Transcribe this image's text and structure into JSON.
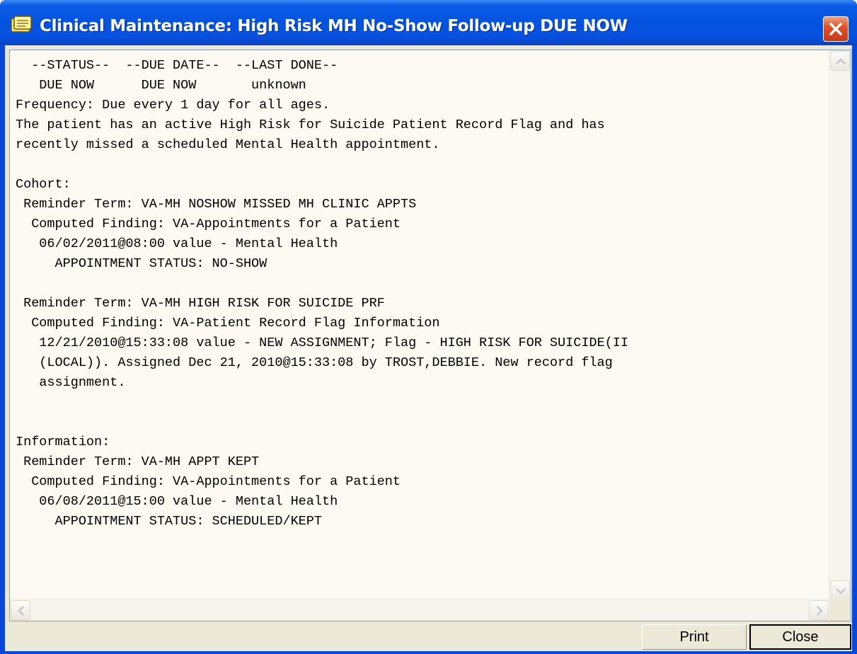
{
  "window": {
    "title": "Clinical Maintenance: High Risk MH No-Show Follow-up DUE NOW",
    "title_icon": "notepad-icon",
    "close_icon": "close-icon"
  },
  "colors": {
    "titlebar": "#0453de",
    "close_button": "#e0522c",
    "text_background": "#fdfaf3",
    "dialog_face": "#ece9d8"
  },
  "content": {
    "text": "  --STATUS--  --DUE DATE--  --LAST DONE--\n   DUE NOW      DUE NOW       unknown\nFrequency: Due every 1 day for all ages.\nThe patient has an active High Risk for Suicide Patient Record Flag and has\nrecently missed a scheduled Mental Health appointment.\n\nCohort:\n Reminder Term: VA-MH NOSHOW MISSED MH CLINIC APPTS\n  Computed Finding: VA-Appointments for a Patient\n   06/02/2011@08:00 value - Mental Health\n     APPOINTMENT STATUS: NO-SHOW\n\n Reminder Term: VA-MH HIGH RISK FOR SUICIDE PRF\n  Computed Finding: VA-Patient Record Flag Information\n   12/21/2010@15:33:08 value - NEW ASSIGNMENT; Flag - HIGH RISK FOR SUICIDE(II\n   (LOCAL)). Assigned Dec 21, 2010@15:33:08 by TROST,DEBBIE. New record flag\n   assignment.\n\n\nInformation:\n Reminder Term: VA-MH APPT KEPT\n  Computed Finding: VA-Appointments for a Patient\n   06/08/2011@15:00 value - Mental Health\n     APPOINTMENT STATUS: SCHEDULED/KEPT"
  },
  "scrollbars": {
    "up_icon": "scroll-up-icon",
    "down_icon": "scroll-down-icon",
    "left_icon": "scroll-left-icon",
    "right_icon": "scroll-right-icon"
  },
  "buttons": {
    "print_label": "Print",
    "close_label": "Close"
  }
}
